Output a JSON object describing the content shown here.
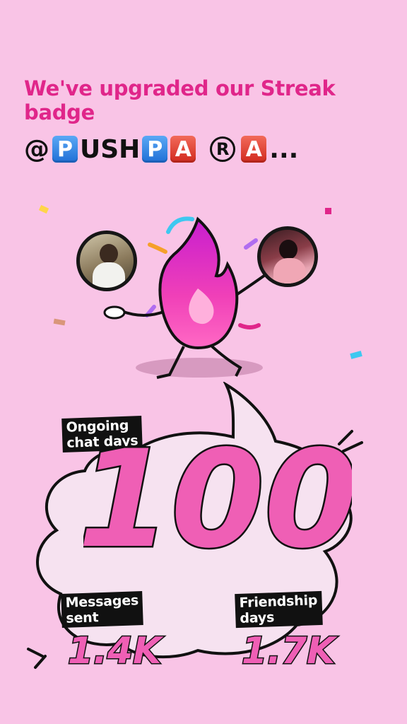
{
  "headline": "We've upgraded our Streak badge",
  "handle": {
    "at": "@",
    "t1": "P",
    "s1": "USH",
    "t2": "P",
    "t3": "A",
    "reg": "R",
    "t4": "A",
    "dots": "..."
  },
  "stats": {
    "chat_label_1": "Ongoing",
    "chat_label_2": "chat days",
    "chat_value": "100",
    "msgs_label_1": "Messages",
    "msgs_label_2": "sent",
    "msgs_value": "1.4K",
    "friend_label_1": "Friendship",
    "friend_label_2": "days",
    "friend_value": "1.7K"
  },
  "colors": {
    "background": "#f9c4e6",
    "accent": "#e0268a",
    "number_fill": "#ef5fb5"
  },
  "icons": [
    "flame-mascot-icon",
    "confetti-icon",
    "speech-bubble-icon"
  ]
}
